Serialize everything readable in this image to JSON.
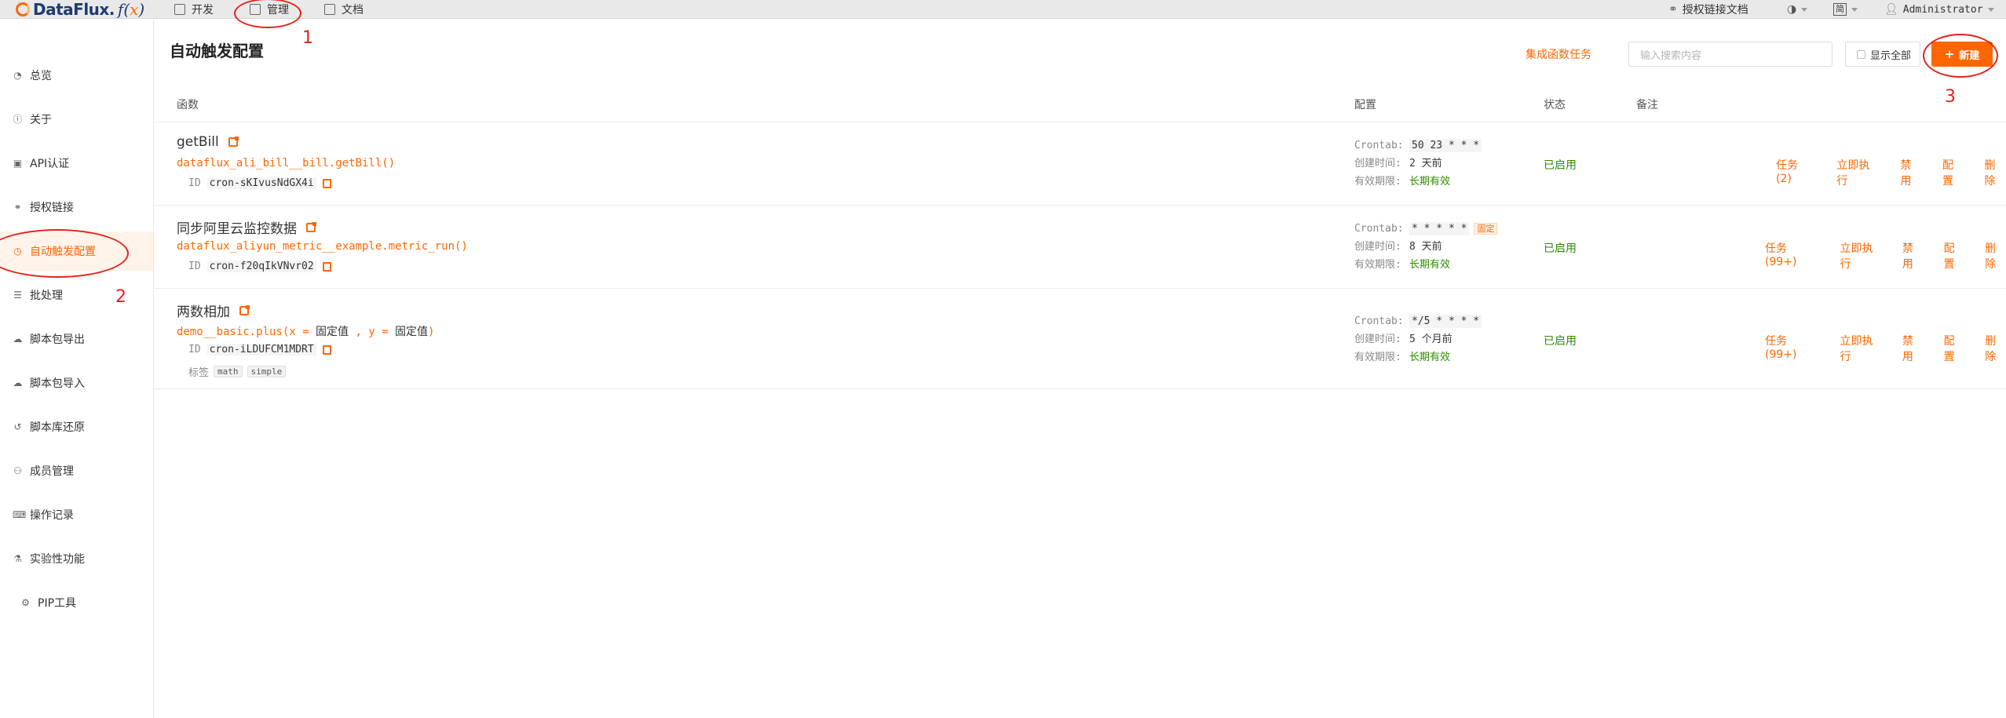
{
  "topbar": {
    "logo_text": "DataFlux.",
    "nav": [
      {
        "label": "开发",
        "icon": "edit-icon"
      },
      {
        "label": "管理",
        "icon": "manage-icon"
      },
      {
        "label": "文档",
        "icon": "book-icon"
      }
    ],
    "auth_link_doc": "授权链接文档",
    "lang": "简",
    "user": "Administrator"
  },
  "annotations": [
    "1",
    "2",
    "3"
  ],
  "sidebar": {
    "items": [
      {
        "label": "总览",
        "icon": "dashboard-icon"
      },
      {
        "label": "关于",
        "icon": "info-icon"
      },
      {
        "label": "API认证",
        "icon": "lock-icon"
      },
      {
        "label": "授权链接",
        "icon": "link-icon"
      },
      {
        "label": "自动触发配置",
        "icon": "clock-icon",
        "active": true
      },
      {
        "label": "批处理",
        "icon": "list-icon"
      },
      {
        "label": "脚本包导出",
        "icon": "cloud-download-icon"
      },
      {
        "label": "脚本包导入",
        "icon": "cloud-upload-icon"
      },
      {
        "label": "脚本库还原",
        "icon": "history-icon"
      },
      {
        "label": "成员管理",
        "icon": "users-icon"
      },
      {
        "label": "操作记录",
        "icon": "keyboard-icon"
      },
      {
        "label": "实验性功能",
        "icon": "flask-icon"
      },
      {
        "label": "PIP工具",
        "icon": "cubes-icon"
      }
    ]
  },
  "main": {
    "title": "自动触发配置",
    "integration_link": "集成函数任务",
    "search_placeholder": "输入搜索内容",
    "show_all": "显示全部",
    "new_button": "新建",
    "new_button_icon": "+",
    "columns": {
      "func": "函数",
      "config": "配置",
      "status": "状态",
      "note": "备注"
    },
    "labels": {
      "crontab": "Crontab:",
      "created": "创建时间:",
      "valid": "有效期限:",
      "id": "ID",
      "tags": "标签"
    },
    "rows": [
      {
        "title": "getBill",
        "code_name": "dataflux_ali_bill__bill.getBill()",
        "id": "cron-sKIvusNdGX4i",
        "crontab": "50 23 * * *",
        "created": "2 天前",
        "valid": "长期有效",
        "status": "已启用",
        "actions": [
          "任务 (2)",
          "立即执行",
          "禁用",
          "配置",
          "删除"
        ]
      },
      {
        "title": "同步阿里云监控数据",
        "code_name": "dataflux_aliyun_metric__example.metric_run()",
        "id": "cron-f20qIkVNvr02",
        "crontab": "* * * * *",
        "fixed_tag": "固定",
        "created": "8 天前",
        "valid": "长期有效",
        "status": "已启用",
        "actions": [
          "任务 (99+)",
          "立即执行",
          "禁用",
          "配置",
          "删除"
        ]
      },
      {
        "title": "两数相加",
        "code_prefix": "demo__basic.plus(x = ",
        "code_mid1": "固定值",
        "code_sep": " , y = ",
        "code_mid2": "固定值",
        "code_suffix": ")",
        "id": "cron-iLDUFCM1MDRT",
        "tags": [
          "math",
          "simple"
        ],
        "crontab": "*/5 * * * *",
        "created": "5 个月前",
        "valid": "长期有效",
        "status": "已启用",
        "actions": [
          "任务 (99+)",
          "立即执行",
          "禁用",
          "配置",
          "删除"
        ]
      }
    ]
  },
  "colors": {
    "accent": "#ff6600",
    "enabled": "#2e8b00",
    "annotation": "#e2231a"
  }
}
